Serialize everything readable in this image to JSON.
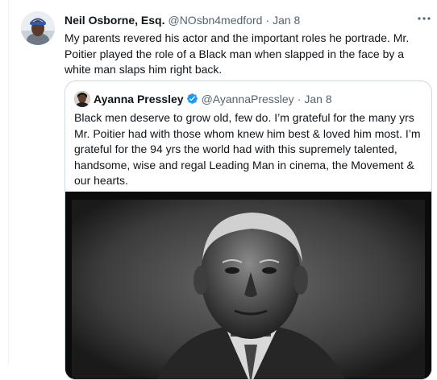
{
  "tweet": {
    "author_name": "Neil Osborne, Esq.",
    "handle": "@NOsbn4medford",
    "separator": "·",
    "time": "Jan 8",
    "more_icon": "more-horizontal-icon",
    "text": "My parents revered his actor and the important roles he portrade. Mr. Poitier played the role of a Black man when slapped in the face by a white man slaps him right back."
  },
  "quote": {
    "author_name": "Ayanna Pressley",
    "verified_icon": "verified-badge-icon",
    "verified_color": "#1d9bf0",
    "handle": "@AyannaPressley",
    "separator": "·",
    "time": "Jan 8",
    "text": "Black men deserve to grow old, few do. I’m grateful for the many yrs Mr. Poitier had with those whom knew him best & loved him most. I’m grateful for the 94 yrs the world had with this supremely talented, handsome, wise and regal Leading Man in cinema, the Movement &  our hearts."
  },
  "colors": {
    "text_primary": "#0f1419",
    "text_secondary": "#536471",
    "border": "#cfd9de"
  }
}
